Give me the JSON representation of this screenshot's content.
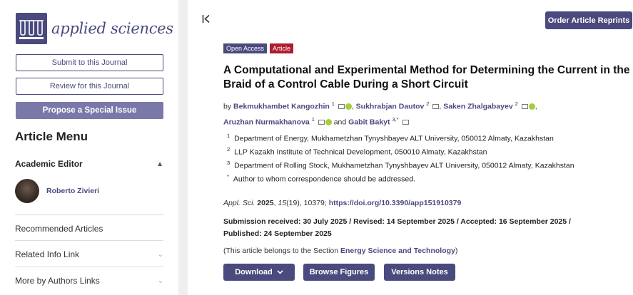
{
  "journal": {
    "name": "applied sciences"
  },
  "sidebar": {
    "submit_label": "Submit to this Journal",
    "review_label": "Review for this Journal",
    "propose_label": "Propose a Special Issue",
    "menu_title": "Article Menu",
    "academic_editor_heading": "Academic Editor",
    "editor_name": "Roberto Zivieri",
    "items": [
      {
        "label": "Recommended Articles"
      },
      {
        "label": "Related Info Link"
      },
      {
        "label": "More by Authors Links"
      }
    ]
  },
  "header": {
    "reprints_label": "Order Article Reprints"
  },
  "article": {
    "badge_open_access": "Open Access",
    "badge_type": "Article",
    "title": "A Computational and Experimental Method for Determining the Current in the Braid of a Control Cable During a Short Circuit",
    "by": "by",
    "authors": [
      {
        "name": "Bekmukhambet Kangozhin",
        "sup": "1"
      },
      {
        "name": "Sukhrabjan Dautov",
        "sup": "2"
      },
      {
        "name": "Saken Zhalgabayev",
        "sup": "2"
      },
      {
        "name": "Aruzhan Nurmakhanova",
        "sup": "1"
      },
      {
        "name": "Gabit Bakyt",
        "sup": "3,*"
      }
    ],
    "and": "and",
    "affiliations": [
      {
        "sup": "1",
        "text": "Department of Energy, Mukhametzhan Tynyshbayev ALT University, 050012 Almaty, Kazakhstan"
      },
      {
        "sup": "2",
        "text": "LLP Kazakh Institute of Technical Development, 050010 Almaty, Kazakhstan"
      },
      {
        "sup": "3",
        "text": "Department of Rolling Stock, Mukhametzhan Tynyshbayev ALT University, 050012 Almaty, Kazakhstan"
      },
      {
        "sup": "*",
        "text": "Author to whom correspondence should be addressed."
      }
    ],
    "citation": {
      "journal": "Appl. Sci.",
      "year": "2025",
      "volume": "15",
      "issue": "(19), 10379; ",
      "doi": "https://doi.org/10.3390/app151910379"
    },
    "dates": "Submission received: 30 July 2025 / Revised: 14 September 2025 / Accepted: 16 September 2025 / Published: 24 September 2025",
    "section_prefix": "(This article belongs to the Section ",
    "section_name": "Energy Science and Technology",
    "section_suffix": ")"
  },
  "actions": {
    "download_label": "Download",
    "browse_label": "Browse Figures",
    "versions_label": "Versions Notes"
  }
}
